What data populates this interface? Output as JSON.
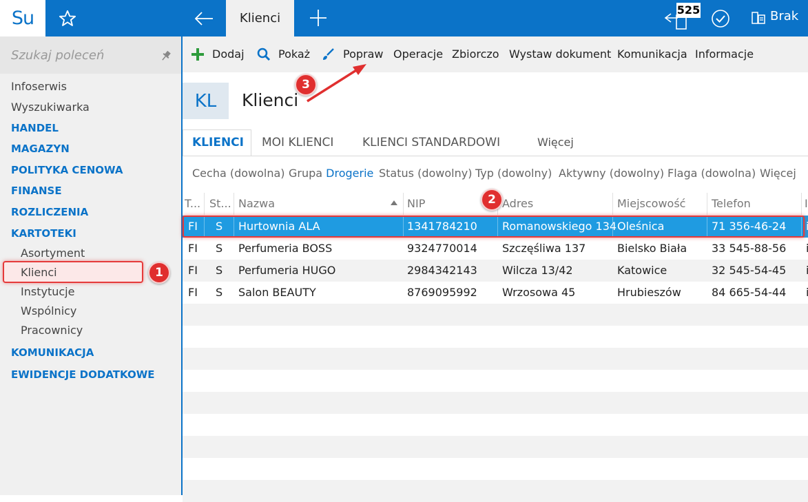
{
  "app": {
    "logo": "Su",
    "active_tab": "Klienci",
    "notification_count": "525",
    "status_label": "Brak"
  },
  "sidebar": {
    "search_placeholder": "Szukaj poleceń",
    "items": [
      {
        "label": "Infoserwis",
        "kind": "plain"
      },
      {
        "label": "Wyszukiwarka",
        "kind": "plain"
      },
      {
        "label": "HANDEL",
        "kind": "section"
      },
      {
        "label": "MAGAZYN",
        "kind": "section"
      },
      {
        "label": "POLITYKA CENOWA",
        "kind": "section"
      },
      {
        "label": "FINANSE",
        "kind": "section"
      },
      {
        "label": "ROZLICZENIA",
        "kind": "section"
      },
      {
        "label": "KARTOTEKI",
        "kind": "section"
      },
      {
        "label": "Asortyment",
        "kind": "sub"
      },
      {
        "label": "Klienci",
        "kind": "sub"
      },
      {
        "label": "Instytucje",
        "kind": "sub"
      },
      {
        "label": "Wspólnicy",
        "kind": "sub"
      },
      {
        "label": "Pracownicy",
        "kind": "sub"
      },
      {
        "label": "KOMUNIKACJA",
        "kind": "section"
      },
      {
        "label": "EWIDENCJE DODATKOWE",
        "kind": "section"
      }
    ]
  },
  "toolbar": {
    "add": "Dodaj",
    "show": "Pokaż",
    "edit": "Popraw",
    "operations": "Operacje",
    "bulk": "Zbiorczo",
    "issue_document": "Wystaw dokument",
    "communication": "Komunikacja",
    "information": "Informacje"
  },
  "header": {
    "abbr": "KL",
    "title": "Klienci"
  },
  "tabs": [
    "KLIENCI",
    "MOI KLIENCI",
    "KLIENCI STANDARDOWI",
    "Więcej"
  ],
  "filters": {
    "feature": "Cecha (dowolna)",
    "group_label": "Grupa",
    "group_value": "Drogerie",
    "status": "Status (dowolny)",
    "type": "Typ (dowolny)",
    "active": "Aktywny (dowolny)",
    "flag": "Flaga (dowolna)",
    "more": "Więcej"
  },
  "table": {
    "columns": [
      "T...",
      "St...",
      "Nazwa",
      "NIP",
      "Adres",
      "Miejscowość",
      "Telefon",
      "I"
    ],
    "rows": [
      {
        "t": "FI",
        "st": "S",
        "name": "Hurtownia ALA",
        "nip": "1341784210",
        "address": "Romanowskiego 134",
        "city": "Oleśnica",
        "phone": "71 356-46-24",
        "extra": "i"
      },
      {
        "t": "FI",
        "st": "S",
        "name": "Perfumeria BOSS",
        "nip": "9324770014",
        "address": "Szczęśliwa  137",
        "city": "Bielsko Biała",
        "phone": "33 545-88-56",
        "extra": "i"
      },
      {
        "t": "FI",
        "st": "S",
        "name": "Perfumeria HUGO",
        "nip": "2984342143",
        "address": "Wilcza  13/42",
        "city": "Katowice",
        "phone": "32 545-54-45",
        "extra": "i"
      },
      {
        "t": "FI",
        "st": "S",
        "name": "Salon BEAUTY",
        "nip": "8769095992",
        "address": "Wrzosowa  45",
        "city": "Hrubieszów",
        "phone": "84 665-54-44",
        "extra": "i"
      }
    ]
  },
  "callouts": [
    "1",
    "2",
    "3"
  ],
  "colors": {
    "accent": "#0b73c8",
    "selected_row": "#1f9be1",
    "callout": "#e02f2f",
    "add_icon": "#2e9b3c"
  }
}
